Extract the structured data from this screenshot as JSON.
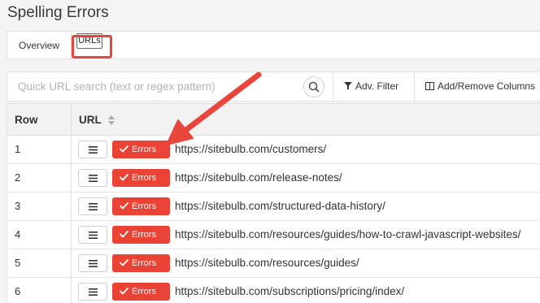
{
  "page": {
    "title": "Spelling Errors"
  },
  "tabs": [
    {
      "label": "Overview"
    },
    {
      "label": "URLs"
    }
  ],
  "toolbar": {
    "search_placeholder": "Quick URL search (text or regex pattern)",
    "search_value": "",
    "filter_label": "Adv. Filter",
    "columns_label": "Add/Remove Columns"
  },
  "table": {
    "columns": [
      "Row",
      "URL"
    ],
    "error_label": "Errors",
    "rows": [
      {
        "row": "1",
        "url": "https://sitebulb.com/customers/"
      },
      {
        "row": "2",
        "url": "https://sitebulb.com/release-notes/"
      },
      {
        "row": "3",
        "url": "https://sitebulb.com/structured-data-history/"
      },
      {
        "row": "4",
        "url": "https://sitebulb.com/resources/guides/how-to-crawl-javascript-websites/"
      },
      {
        "row": "5",
        "url": "https://sitebulb.com/resources/guides/"
      },
      {
        "row": "6",
        "url": "https://sitebulb.com/subscriptions/pricing/index/"
      }
    ]
  },
  "colors": {
    "accent_red": "#ea4335",
    "annotation_red": "#e8453c"
  },
  "icons": {
    "search": "search-icon",
    "filter": "filter-icon",
    "columns": "columns-icon",
    "sort": "sort-icon",
    "menu": "menu-icon",
    "check": "check-icon"
  }
}
